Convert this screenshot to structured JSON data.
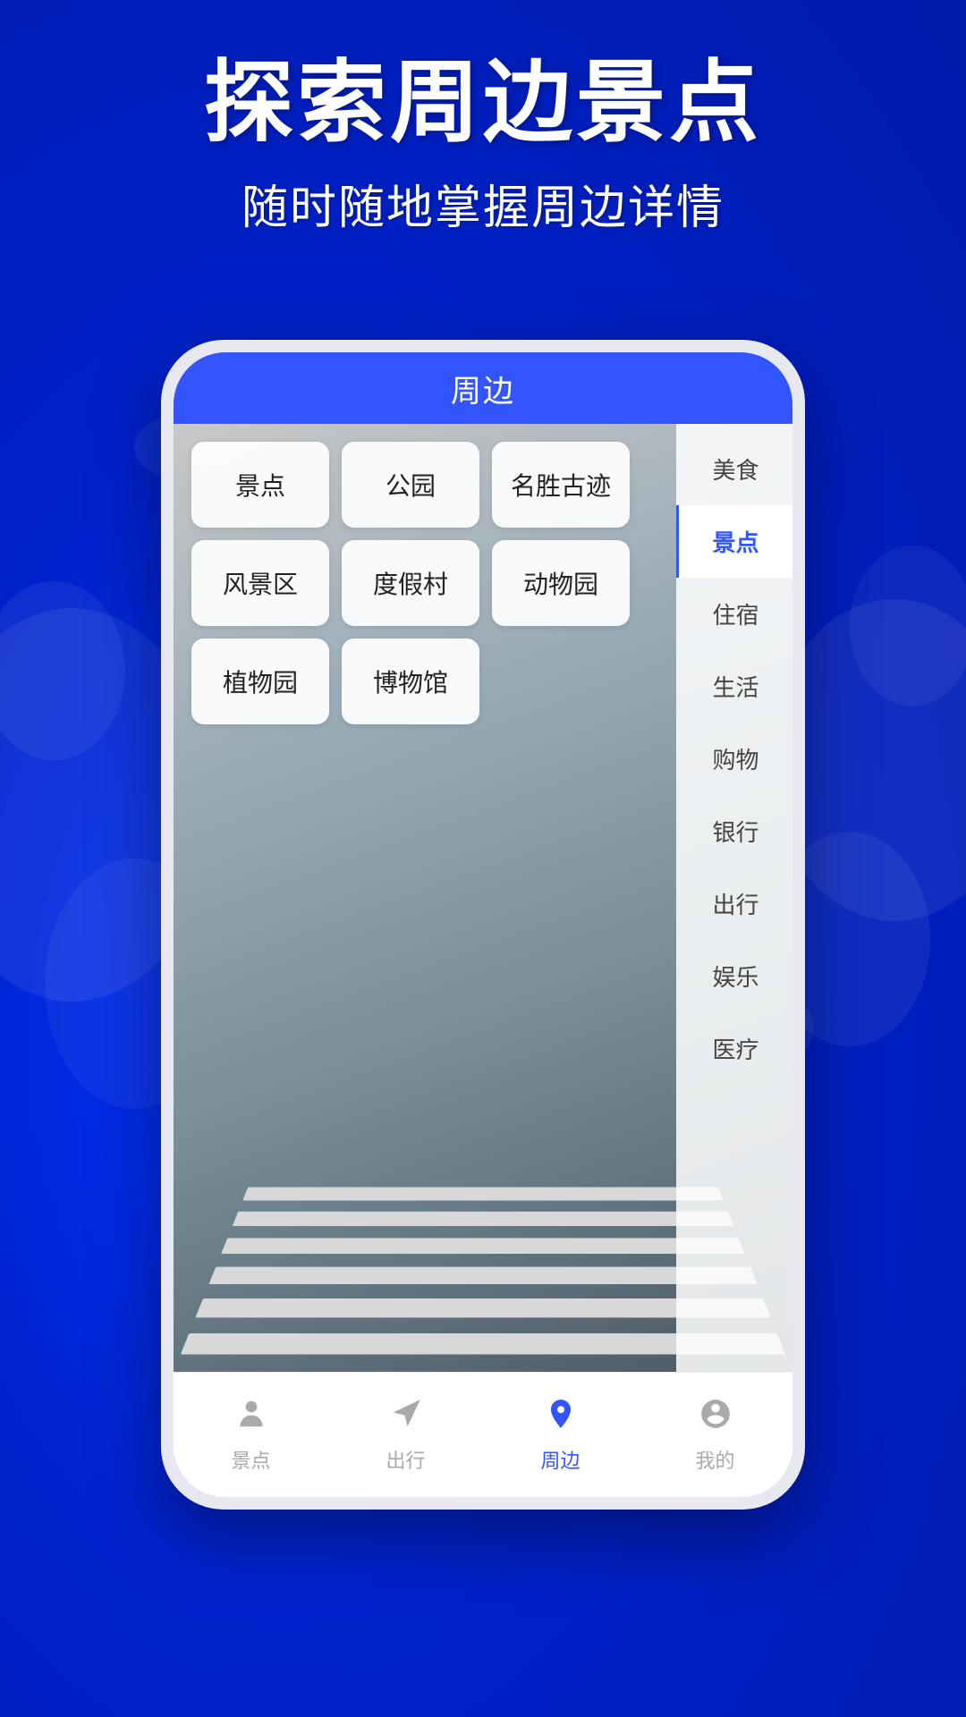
{
  "hero": {
    "title": "探索周边景点",
    "subtitle": "随时随地掌握周边详情"
  },
  "phone": {
    "topbar_title": "周边"
  },
  "categories": [
    {
      "id": "jingdian",
      "label": "景点"
    },
    {
      "id": "gongyuan",
      "label": "公园"
    },
    {
      "id": "mingsheng",
      "label": "名胜古迹"
    },
    {
      "id": "fengjingqu",
      "label": "风景区"
    },
    {
      "id": "dujiacun",
      "label": "度假村"
    },
    {
      "id": "dongwuyuan",
      "label": "动物园"
    },
    {
      "id": "zhiwuyuan",
      "label": "植物园"
    },
    {
      "id": "bowuguan",
      "label": "博物馆"
    }
  ],
  "sidebar": {
    "items": [
      {
        "id": "meishi",
        "label": "美食",
        "active": false
      },
      {
        "id": "jingdian",
        "label": "景点",
        "active": true
      },
      {
        "id": "zhushu",
        "label": "住宿",
        "active": false
      },
      {
        "id": "shenghuo",
        "label": "生活",
        "active": false
      },
      {
        "id": "gouwu",
        "label": "购物",
        "active": false
      },
      {
        "id": "yinhang",
        "label": "银行",
        "active": false
      },
      {
        "id": "chuxing",
        "label": "出行",
        "active": false
      },
      {
        "id": "yule",
        "label": "娱乐",
        "active": false
      },
      {
        "id": "yiliao",
        "label": "医疗",
        "active": false
      }
    ]
  },
  "bottom_nav": {
    "items": [
      {
        "id": "jingdian",
        "label": "景点",
        "icon": "person",
        "active": false
      },
      {
        "id": "chuxing",
        "label": "出行",
        "icon": "navigate",
        "active": false
      },
      {
        "id": "zhoubian",
        "label": "周边",
        "icon": "location",
        "active": true
      },
      {
        "id": "wode",
        "label": "我的",
        "icon": "account",
        "active": false
      }
    ]
  },
  "colors": {
    "brand_blue": "#3355ff",
    "active_color": "#3355ff",
    "inactive_color": "#aaaaaa"
  }
}
